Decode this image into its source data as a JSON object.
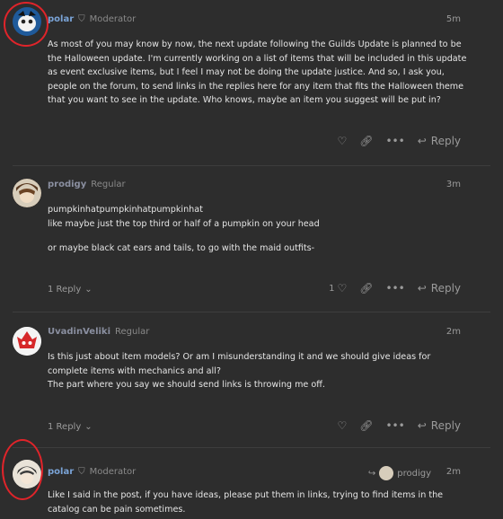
{
  "posts": [
    {
      "username": "polar",
      "title": "Moderator",
      "time": "5m",
      "paragraphs": [
        "As most of you may know by now, the next update following the Guilds Update is planned to be the Halloween update. I'm currently working on a list of items that will be included in this update as event exclusive items, but I feel I may not be doing the update justice. And so, I ask you, people on the forum, to send links in the replies here for any item that fits the Halloween theme that you want to see in the update. Who knows, maybe an item you suggest will be put in?"
      ],
      "reply_label": "Reply"
    },
    {
      "username": "prodigy",
      "title": "Regular",
      "time": "3m",
      "paragraphs": [
        "pumpkinhatpumpkinhatpumpkinhat",
        "like maybe just the top third or half of a pumpkin on your head",
        "or maybe black cat ears and tails, to go with the maid outfits-"
      ],
      "replies_label": "1 Reply",
      "like_count": "1",
      "reply_label": "Reply"
    },
    {
      "username": "UvadinVeliki",
      "title": "Regular",
      "time": "2m",
      "paragraphs": [
        "Is this just about item models? Or am I misunderstanding it and we should give ideas for complete items with mechanics and all?",
        "The part where you say we should send links is throwing me off."
      ],
      "replies_label": "1 Reply",
      "reply_label": "Reply"
    },
    {
      "username": "polar",
      "title": "Moderator",
      "time": "2m",
      "reply_to": "prodigy",
      "paragraphs": [
        "Like I said in the post, if you have ideas, please put them in links, trying to find items in the catalog can be pain sometimes."
      ]
    }
  ],
  "colors": {
    "background": "#2d2d2d",
    "username_link": "#7aa3d6",
    "annotation_red": "#e0242a"
  }
}
